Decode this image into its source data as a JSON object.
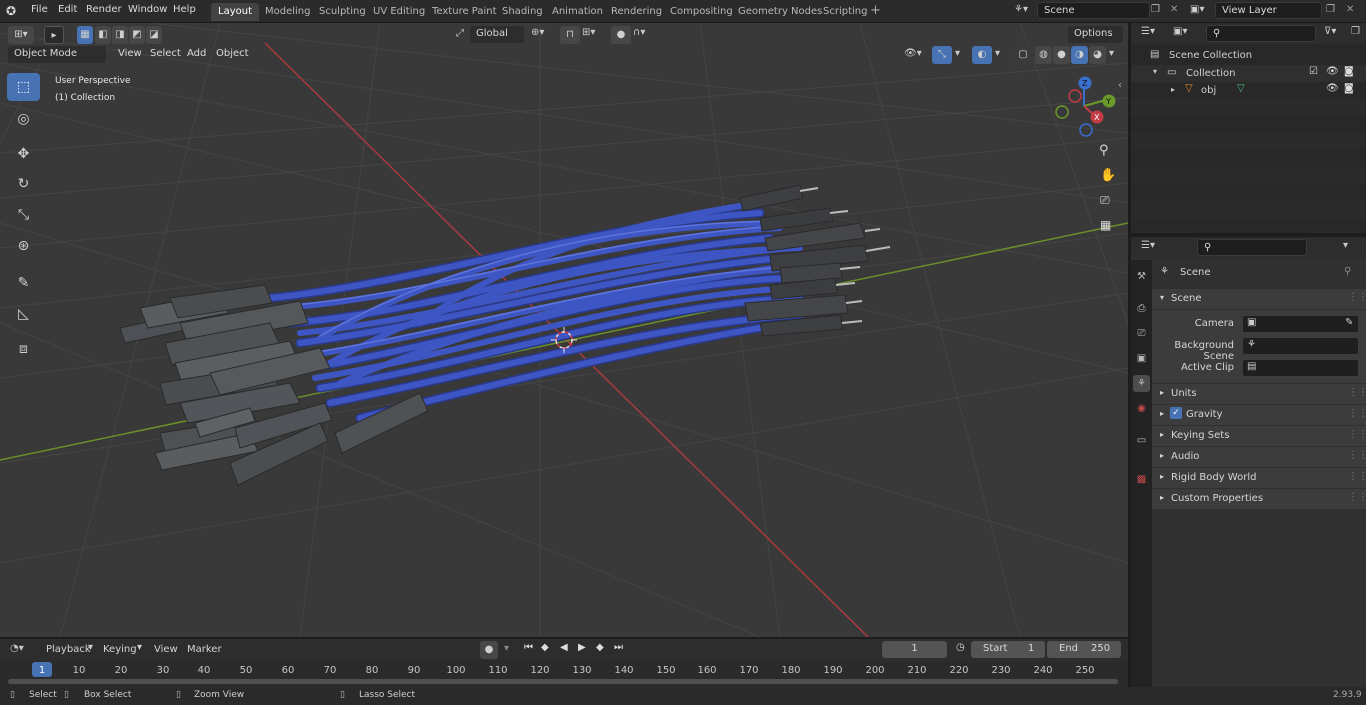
{
  "menubar": {
    "items": [
      "File",
      "Edit",
      "Render",
      "Window",
      "Help"
    ]
  },
  "workspaces": [
    "Layout",
    "Modeling",
    "Sculpting",
    "UV Editing",
    "Texture Paint",
    "Shading",
    "Animation",
    "Rendering",
    "Compositing",
    "Geometry Nodes",
    "Scripting"
  ],
  "active_workspace": "Layout",
  "scene_field": "Scene",
  "view_layer_field": "View Layer",
  "viewport_header": {
    "orientation": "Global",
    "options_label": "Options",
    "mode": "Object Mode",
    "menus": [
      "View",
      "Select",
      "Add",
      "Object"
    ]
  },
  "viewport": {
    "perspective_label": "User Perspective",
    "collection_label": "(1) Collection",
    "gizmo_axes": {
      "z": "Z",
      "y": "Y",
      "x": "X"
    }
  },
  "outliner": {
    "scene_collection": "Scene Collection",
    "collection": "Collection",
    "object": "obj"
  },
  "properties": {
    "header": "Scene",
    "panel_scene": "Scene",
    "camera_label": "Camera",
    "background_scene_label": "Background Scene",
    "active_clip_label": "Active Clip",
    "panels": [
      "Units",
      "Gravity",
      "Keying Sets",
      "Audio",
      "Rigid Body World",
      "Custom Properties"
    ],
    "gravity_checked": true
  },
  "timeline": {
    "menus": [
      "Playback",
      "Keying",
      "View",
      "Marker"
    ],
    "current_frame": "1",
    "start_label": "Start",
    "start_value": "1",
    "end_label": "End",
    "end_value": "250",
    "ticks": [
      "1",
      "10",
      "20",
      "30",
      "40",
      "50",
      "60",
      "70",
      "80",
      "90",
      "100",
      "110",
      "120",
      "130",
      "140",
      "150",
      "160",
      "170",
      "180",
      "190",
      "200",
      "210",
      "220",
      "230",
      "240",
      "250"
    ]
  },
  "statusbar": {
    "select": "Select",
    "box_select": "Box Select",
    "zoom_view": "Zoom View",
    "lasso_select": "Lasso Select",
    "version": "2.93.9"
  },
  "colors": {
    "accent": "#4772b3",
    "cable": "#3e55c4",
    "x_axis": "#a83a3f",
    "y_axis": "#6b8f2a"
  }
}
